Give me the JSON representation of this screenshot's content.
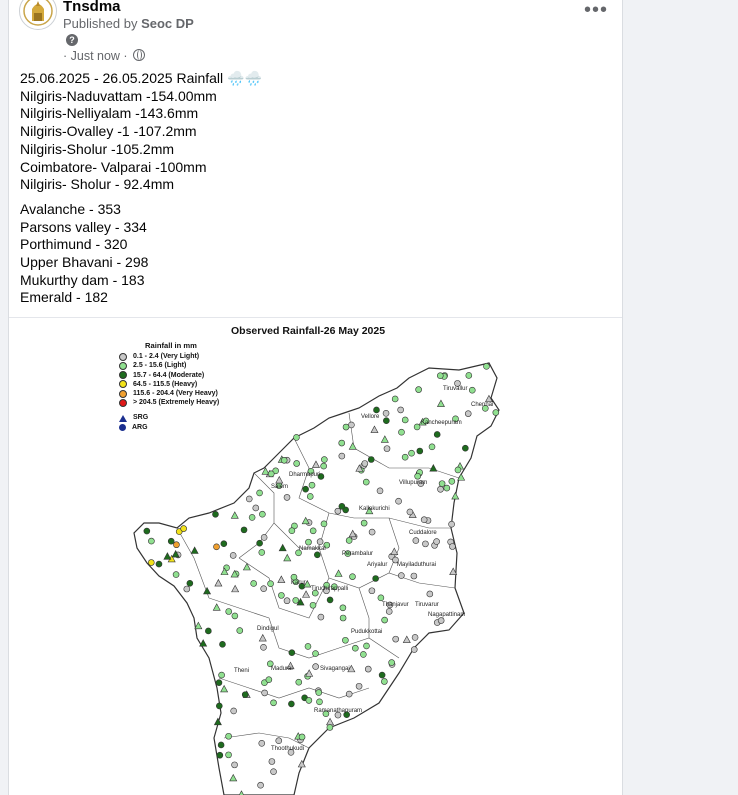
{
  "post": {
    "page_name": "Tnsdma",
    "published_by_prefix": "Published by ",
    "publisher": "Seoc DP",
    "info_icon": "?",
    "timestamp": "· Just now ·",
    "audience_icon": "globe-icon",
    "more_icon": "•••"
  },
  "post_text": {
    "lines_block1": [
      "25.06.2025 - 26.05.2025 Rainfall 🌧️🌧️",
      "Nilgiris-Naduvattam -154.00mm",
      "Nilgiris-Nelliyalam -143.6mm",
      "Nilgiris-Ovalley -1 -107.2mm",
      "Nilgiris-Sholur -105.2mm",
      "Coimbatore- Valparai -100mm",
      "Nilgiris- Sholur - 92.4mm"
    ],
    "lines_block2": [
      "Avalanche - 353",
      "Parsons valley - 334",
      "Porthimund - 320",
      "Upper Bhavani - 298",
      "Mukurthy dam - 183",
      "Emerald - 182"
    ]
  },
  "map": {
    "title": "Observed Rainfall-26 May 2025",
    "legend_title": "Rainfall in mm",
    "legend": [
      {
        "label": "0.1 - 2.4 (Very Light)",
        "color": "#c8c8c8"
      },
      {
        "label": "2.5 - 15.6 (Light)",
        "color": "#90e090"
      },
      {
        "label": "15.7 - 64.4 (Moderate)",
        "color": "#1e6b1e"
      },
      {
        "label": "64.5 - 115.5 (Heavy)",
        "color": "#f2e21a"
      },
      {
        "label": "115.6 - 204.4 (Very Heavy)",
        "color": "#f0a030"
      },
      {
        "label": "> 204.5 (Extremely Heavy)",
        "color": "#e01818"
      }
    ],
    "station_types": [
      {
        "label": "SRG",
        "shape": "triangle",
        "color": "#1b2f8f"
      },
      {
        "label": "ARG",
        "shape": "circle",
        "color": "#1b2f8f"
      }
    ],
    "place_labels": [
      "Tiruvallur",
      "Chennai",
      "Vellore",
      "Kancheepuram",
      "Villupuram",
      "Kallakurichi",
      "Cuddalore",
      "Perambalur",
      "Ariyalur",
      "Mayiladuthurai",
      "Thanjavur",
      "Tiruvarur",
      "Nagapattinam",
      "Pudukkottai",
      "Sivagangai",
      "Ramanathapuram",
      "Thoothukudi",
      "Madurai",
      "Theni",
      "Dindigul",
      "Tiruchirappalli",
      "Karur",
      "Namakkal",
      "Salem",
      "Dharmapuri"
    ]
  }
}
